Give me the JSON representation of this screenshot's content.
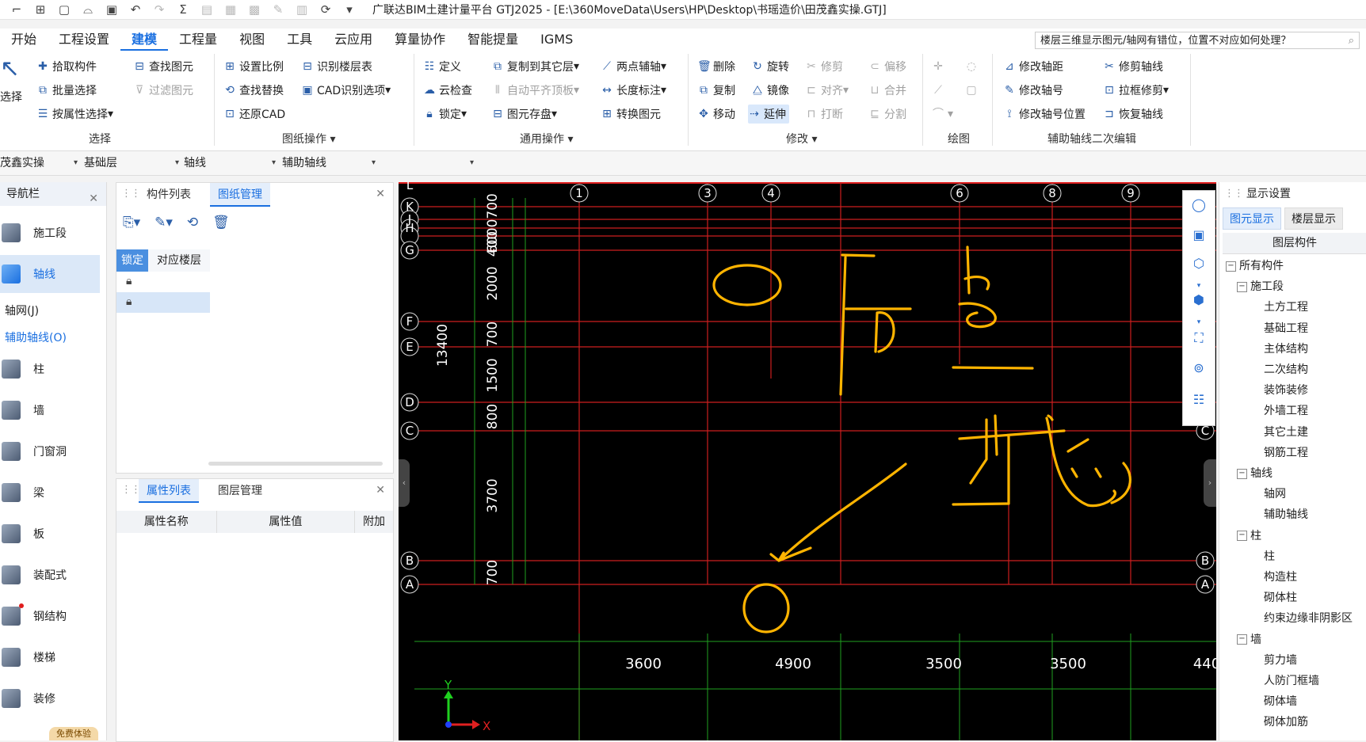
{
  "titlebar": {
    "title": "广联达BIM土建计量平台 GTJ2025 - [E:\\360MoveData\\Users\\HP\\Desktop\\书瑶造价\\田茂鑫实操.GTJ]"
  },
  "menu": {
    "items": [
      "开始",
      "工程设置",
      "建模",
      "工程量",
      "视图",
      "工具",
      "云应用",
      "算量协作",
      "智能提量",
      "IGMS"
    ],
    "active_index": 2,
    "question": "楼层三维显示图元/轴网有错位，位置不对应如何处理？"
  },
  "ribbon": {
    "select_label": "选择",
    "pick": "拾取构件",
    "batch": "批量选择",
    "by_attr": "按属性选择",
    "find": "查找图元",
    "filter": "过滤图元",
    "group_select": "选择",
    "set_ratio": "设置比例",
    "find_replace": "查找替换",
    "restore_cad": "还原CAD",
    "identify_floor": "识别楼层表",
    "cad_options": "CAD识别选项",
    "group_drawing": "图纸操作",
    "define": "定义",
    "cloud_check": "云检查",
    "lock": "锁定",
    "copy_other": "复制到其它层",
    "auto_flush": "自动平齐顶板",
    "elem_store": "图元存盘",
    "two_point": "两点辅轴",
    "length_dim": "长度标注",
    "convert": "转换图元",
    "group_common": "通用操作",
    "delete": "删除",
    "copy": "复制",
    "move": "移动",
    "rotate": "旋转",
    "mirror": "镜像",
    "extend": "延伸",
    "trim": "修剪",
    "align": "对齐",
    "break": "打断",
    "offset": "偏移",
    "merge": "合并",
    "split": "分割",
    "group_modify": "修改",
    "group_draw": "绘图",
    "mod_axis_dist": "修改轴距",
    "mod_axis_num": "修改轴号",
    "mod_axis_pos": "修改轴号位置",
    "trim_axis": "修剪轴线",
    "box_trim": "拉框修剪",
    "restore_axis": "恢复轴线",
    "group_aux": "辅助轴线二次编辑"
  },
  "layerbar": {
    "project": "茂鑫实操",
    "floor": "基础层",
    "type": "轴线",
    "sub": "辅助轴线",
    "extra": ""
  },
  "nav": {
    "title": "导航栏",
    "items": [
      "施工段",
      "轴线",
      "柱",
      "墙",
      "门窗洞",
      "梁",
      "板",
      "装配式",
      "钢结构",
      "楼梯",
      "装修"
    ],
    "sub_items": [
      "轴网(J)",
      "辅助轴线(O)"
    ],
    "trial_badge": "免费体验"
  },
  "components_panel": {
    "tabs": [
      "构件列表",
      "图纸管理"
    ],
    "col_lock": "锁定",
    "col_floor": "对应楼层"
  },
  "props_panel": {
    "tabs": [
      "属性列表",
      "图层管理"
    ],
    "cols": [
      "属性名称",
      "属性值",
      "附加"
    ]
  },
  "canvas": {
    "axis_top": [
      "1",
      "3",
      "4",
      "6",
      "8",
      "9"
    ],
    "axis_left": [
      "L",
      "K",
      "J",
      "H",
      "G",
      "F",
      "E",
      "D",
      "C",
      "B",
      "A"
    ],
    "axis_right": [
      "C",
      "B",
      "A"
    ],
    "dims_left": [
      "700",
      "2000",
      "700",
      "1500",
      "800",
      "3700",
      "700"
    ],
    "dims_left_stack": "6000700",
    "dim_400": "400",
    "dim_total": "13400",
    "dims_bottom": [
      "3600",
      "4900",
      "3500",
      "3500",
      "440"
    ],
    "axis_y": "Y",
    "axis_x": "X",
    "annotation_colors": {
      "ink": "#ffb400"
    }
  },
  "display": {
    "title": "显示设置",
    "tabs": [
      "图元显示",
      "楼层显示"
    ],
    "header": "图层构件",
    "tree": [
      {
        "label": "所有构件",
        "level": 0,
        "box": "−"
      },
      {
        "label": "施工段",
        "level": 1,
        "box": "−"
      },
      {
        "label": "土方工程",
        "level": 2
      },
      {
        "label": "基础工程",
        "level": 2
      },
      {
        "label": "主体结构",
        "level": 2
      },
      {
        "label": "二次结构",
        "level": 2
      },
      {
        "label": "装饰装修",
        "level": 2
      },
      {
        "label": "外墙工程",
        "level": 2
      },
      {
        "label": "其它土建",
        "level": 2
      },
      {
        "label": "钢筋工程",
        "level": 2
      },
      {
        "label": "轴线",
        "level": 1,
        "box": "−"
      },
      {
        "label": "轴网",
        "level": 2
      },
      {
        "label": "辅助轴线",
        "level": 2
      },
      {
        "label": "柱",
        "level": 1,
        "box": "−"
      },
      {
        "label": "柱",
        "level": 2
      },
      {
        "label": "构造柱",
        "level": 2
      },
      {
        "label": "砌体柱",
        "level": 2
      },
      {
        "label": "约束边缘非阴影区",
        "level": 2
      },
      {
        "label": "墙",
        "level": 1,
        "box": "−"
      },
      {
        "label": "剪力墙",
        "level": 2
      },
      {
        "label": "人防门框墙",
        "level": 2
      },
      {
        "label": "砌体墙",
        "level": 2
      },
      {
        "label": "砌体加筋",
        "level": 2
      }
    ]
  }
}
